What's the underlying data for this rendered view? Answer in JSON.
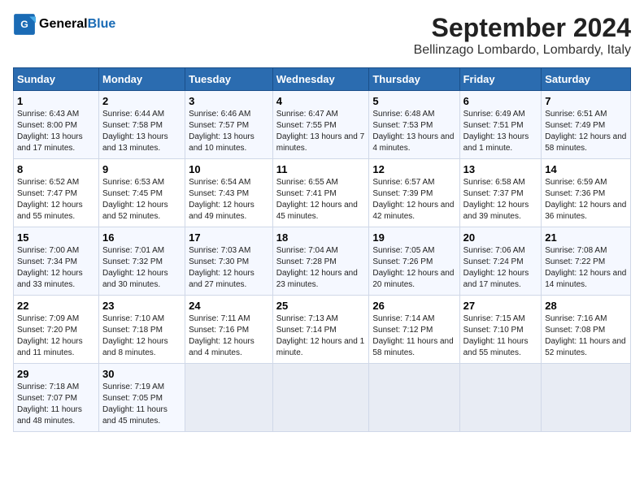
{
  "logo": {
    "line1": "General",
    "line2": "Blue"
  },
  "title": "September 2024",
  "subtitle": "Bellinzago Lombardo, Lombardy, Italy",
  "days_of_week": [
    "Sunday",
    "Monday",
    "Tuesday",
    "Wednesday",
    "Thursday",
    "Friday",
    "Saturday"
  ],
  "weeks": [
    [
      {
        "day": "1",
        "sunrise": "6:43 AM",
        "sunset": "8:00 PM",
        "daylight": "13 hours and 17 minutes."
      },
      {
        "day": "2",
        "sunrise": "6:44 AM",
        "sunset": "7:58 PM",
        "daylight": "13 hours and 13 minutes."
      },
      {
        "day": "3",
        "sunrise": "6:46 AM",
        "sunset": "7:57 PM",
        "daylight": "13 hours and 10 minutes."
      },
      {
        "day": "4",
        "sunrise": "6:47 AM",
        "sunset": "7:55 PM",
        "daylight": "13 hours and 7 minutes."
      },
      {
        "day": "5",
        "sunrise": "6:48 AM",
        "sunset": "7:53 PM",
        "daylight": "13 hours and 4 minutes."
      },
      {
        "day": "6",
        "sunrise": "6:49 AM",
        "sunset": "7:51 PM",
        "daylight": "13 hours and 1 minute."
      },
      {
        "day": "7",
        "sunrise": "6:51 AM",
        "sunset": "7:49 PM",
        "daylight": "12 hours and 58 minutes."
      }
    ],
    [
      {
        "day": "8",
        "sunrise": "6:52 AM",
        "sunset": "7:47 PM",
        "daylight": "12 hours and 55 minutes."
      },
      {
        "day": "9",
        "sunrise": "6:53 AM",
        "sunset": "7:45 PM",
        "daylight": "12 hours and 52 minutes."
      },
      {
        "day": "10",
        "sunrise": "6:54 AM",
        "sunset": "7:43 PM",
        "daylight": "12 hours and 49 minutes."
      },
      {
        "day": "11",
        "sunrise": "6:55 AM",
        "sunset": "7:41 PM",
        "daylight": "12 hours and 45 minutes."
      },
      {
        "day": "12",
        "sunrise": "6:57 AM",
        "sunset": "7:39 PM",
        "daylight": "12 hours and 42 minutes."
      },
      {
        "day": "13",
        "sunrise": "6:58 AM",
        "sunset": "7:37 PM",
        "daylight": "12 hours and 39 minutes."
      },
      {
        "day": "14",
        "sunrise": "6:59 AM",
        "sunset": "7:36 PM",
        "daylight": "12 hours and 36 minutes."
      }
    ],
    [
      {
        "day": "15",
        "sunrise": "7:00 AM",
        "sunset": "7:34 PM",
        "daylight": "12 hours and 33 minutes."
      },
      {
        "day": "16",
        "sunrise": "7:01 AM",
        "sunset": "7:32 PM",
        "daylight": "12 hours and 30 minutes."
      },
      {
        "day": "17",
        "sunrise": "7:03 AM",
        "sunset": "7:30 PM",
        "daylight": "12 hours and 27 minutes."
      },
      {
        "day": "18",
        "sunrise": "7:04 AM",
        "sunset": "7:28 PM",
        "daylight": "12 hours and 23 minutes."
      },
      {
        "day": "19",
        "sunrise": "7:05 AM",
        "sunset": "7:26 PM",
        "daylight": "12 hours and 20 minutes."
      },
      {
        "day": "20",
        "sunrise": "7:06 AM",
        "sunset": "7:24 PM",
        "daylight": "12 hours and 17 minutes."
      },
      {
        "day": "21",
        "sunrise": "7:08 AM",
        "sunset": "7:22 PM",
        "daylight": "12 hours and 14 minutes."
      }
    ],
    [
      {
        "day": "22",
        "sunrise": "7:09 AM",
        "sunset": "7:20 PM",
        "daylight": "12 hours and 11 minutes."
      },
      {
        "day": "23",
        "sunrise": "7:10 AM",
        "sunset": "7:18 PM",
        "daylight": "12 hours and 8 minutes."
      },
      {
        "day": "24",
        "sunrise": "7:11 AM",
        "sunset": "7:16 PM",
        "daylight": "12 hours and 4 minutes."
      },
      {
        "day": "25",
        "sunrise": "7:13 AM",
        "sunset": "7:14 PM",
        "daylight": "12 hours and 1 minute."
      },
      {
        "day": "26",
        "sunrise": "7:14 AM",
        "sunset": "7:12 PM",
        "daylight": "11 hours and 58 minutes."
      },
      {
        "day": "27",
        "sunrise": "7:15 AM",
        "sunset": "7:10 PM",
        "daylight": "11 hours and 55 minutes."
      },
      {
        "day": "28",
        "sunrise": "7:16 AM",
        "sunset": "7:08 PM",
        "daylight": "11 hours and 52 minutes."
      }
    ],
    [
      {
        "day": "29",
        "sunrise": "7:18 AM",
        "sunset": "7:07 PM",
        "daylight": "11 hours and 48 minutes."
      },
      {
        "day": "30",
        "sunrise": "7:19 AM",
        "sunset": "7:05 PM",
        "daylight": "11 hours and 45 minutes."
      },
      null,
      null,
      null,
      null,
      null
    ]
  ],
  "labels": {
    "sunrise": "Sunrise:",
    "sunset": "Sunset:",
    "daylight": "Daylight:"
  }
}
